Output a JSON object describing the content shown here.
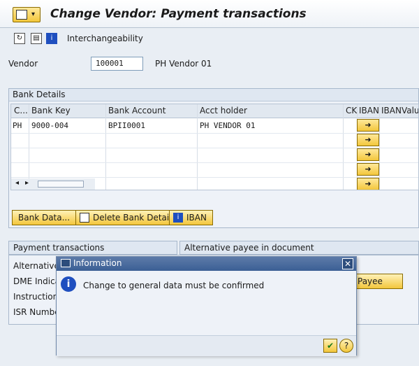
{
  "window": {
    "title": "Change Vendor: Payment transactions"
  },
  "toolbar": {
    "interchangeability_label": "Interchangeability"
  },
  "vendor": {
    "label": "Vendor",
    "value": "100001",
    "name": "PH Vendor 01"
  },
  "bank_details": {
    "title": "Bank Details",
    "columns": [
      "C...",
      "Bank Key",
      "Bank Account",
      "Acct holder",
      "CK",
      "IBAN",
      "IBANValue"
    ],
    "rows": [
      {
        "country": "PH",
        "bank_key": "9000-004",
        "bank_account": "BPII0001",
        "acct_holder": "PH VENDOR 01"
      }
    ],
    "iban_arrow": "➜",
    "buttons": {
      "bank_data": "Bank Data...",
      "delete_bank_detail": "Delete Bank Detail",
      "iban": "IBAN"
    }
  },
  "tabs": {
    "payment_transactions": "Payment transactions",
    "alternative_payee": "Alternative payee in document",
    "fields": {
      "alternative": "Alternative",
      "dme": "DME Indica",
      "instruction": "Instruction",
      "isr": "ISR Numbe"
    },
    "payee_button": "Payee"
  },
  "dialog": {
    "title": "Information",
    "message": "Change to general data must be confirmed",
    "info_glyph": "i",
    "close_glyph": "✕",
    "ok_glyph": "✔",
    "help_glyph": "?"
  }
}
